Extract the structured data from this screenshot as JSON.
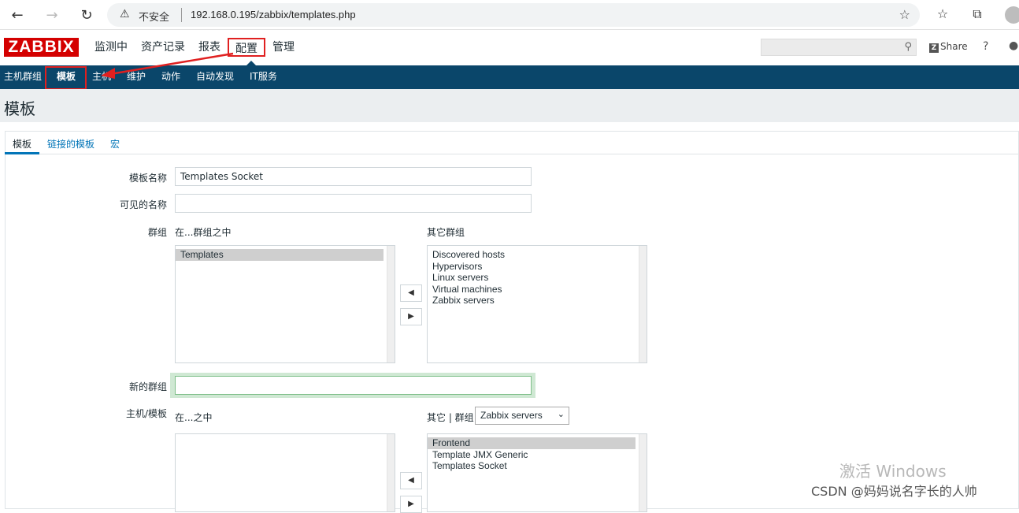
{
  "browser": {
    "insecure_label": "不安全",
    "url": "192.168.0.195/zabbix/templates.php"
  },
  "header": {
    "logo": "ZABBIX",
    "menu": [
      "监测中",
      "资产记录",
      "报表",
      "配置",
      "管理"
    ],
    "selected_menu": "配置",
    "share": "Share",
    "help": "?"
  },
  "submenu": {
    "items": [
      "主机群组",
      "模板",
      "主机",
      "维护",
      "动作",
      "自动发现",
      "IT服务"
    ],
    "selected": "模板"
  },
  "page": {
    "title": "模板"
  },
  "tabs": [
    "模板",
    "链接的模板",
    "宏"
  ],
  "form": {
    "template_name_label": "模板名称",
    "template_name_value": "Templates Socket",
    "visible_name_label": "可见的名称",
    "visible_name_value": "",
    "groups_label": "群组",
    "in_groups_label": "在...群组之中",
    "other_groups_label": "其它群组",
    "in_groups": [
      "Templates"
    ],
    "other_groups": [
      "Discovered hosts",
      "Hypervisors",
      "Linux servers",
      "Virtual machines",
      "Zabbix servers"
    ],
    "new_group_label": "新的群组",
    "new_group_value": "",
    "hosts_label": "主机/模板",
    "in_label": "在...之中",
    "other_group_label": "其它 | 群组",
    "group_select": "Zabbix servers",
    "other_hosts": [
      "Frontend",
      "Template JMX Generic",
      "Templates Socket"
    ]
  },
  "overlay": {
    "activate": "激活 Windows",
    "csdn": "CSDN @妈妈说名字长的人帅"
  },
  "colors": {
    "brand_red": "#d40000",
    "nav_blue": "#0a466a",
    "link_blue": "#0275b8",
    "annotation_red": "#e02020"
  }
}
